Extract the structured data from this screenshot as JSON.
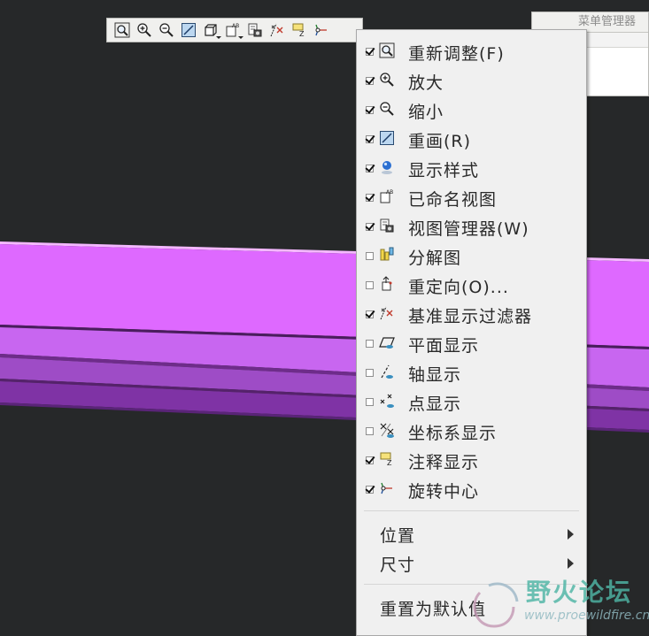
{
  "toolbar": {
    "buttons": [
      {
        "icon": "refit-icon"
      },
      {
        "icon": "zoom-in-icon"
      },
      {
        "icon": "zoom-out-icon"
      },
      {
        "icon": "repaint-icon"
      },
      {
        "icon": "display-style-icon"
      },
      {
        "icon": "named-view-icon"
      },
      {
        "icon": "view-manager-icon"
      },
      {
        "icon": "datum-filter-icon"
      },
      {
        "icon": "note-display-icon"
      },
      {
        "icon": "spin-center-icon"
      }
    ]
  },
  "menu_manager": {
    "title": "菜单管理器"
  },
  "context_menu": {
    "items": [
      {
        "label": "重新调整(F)",
        "checked": true,
        "icon": "refit-icon"
      },
      {
        "label": "放大",
        "checked": true,
        "icon": "zoom-in-icon"
      },
      {
        "label": "缩小",
        "checked": true,
        "icon": "zoom-out-icon"
      },
      {
        "label": "重画(R)",
        "checked": true,
        "icon": "repaint-icon"
      },
      {
        "label": "显示样式",
        "checked": true,
        "icon": "display-style-icon"
      },
      {
        "label": "已命名视图",
        "checked": true,
        "icon": "named-view-icon"
      },
      {
        "label": "视图管理器(W)",
        "checked": true,
        "icon": "view-manager-icon"
      },
      {
        "label": "分解图",
        "checked": false,
        "icon": "explode-view-icon"
      },
      {
        "label": "重定向(O)...",
        "checked": false,
        "icon": "reorient-icon"
      },
      {
        "label": "基准显示过滤器",
        "checked": true,
        "icon": "datum-filter-icon"
      },
      {
        "label": "平面显示",
        "checked": false,
        "icon": "plane-display-icon"
      },
      {
        "label": "轴显示",
        "checked": false,
        "icon": "axis-display-icon"
      },
      {
        "label": "点显示",
        "checked": false,
        "icon": "point-display-icon"
      },
      {
        "label": "坐标系显示",
        "checked": false,
        "icon": "csys-display-icon"
      },
      {
        "label": "注释显示",
        "checked": true,
        "icon": "note-display-icon"
      },
      {
        "label": "旋转中心",
        "checked": true,
        "icon": "spin-center-icon"
      }
    ],
    "submenus": [
      {
        "label": "位置"
      },
      {
        "label": "尺寸"
      }
    ],
    "reset_label": "重置为默认值"
  },
  "watermark": {
    "name": "野火论坛",
    "url": "www.proewildfire.cn"
  },
  "colors": {
    "background": "#262829",
    "part_top": "#e06bff",
    "part_front": "#b255d8",
    "part_dark": "#7a2fa3",
    "menu_bg": "#f0f0f0"
  }
}
